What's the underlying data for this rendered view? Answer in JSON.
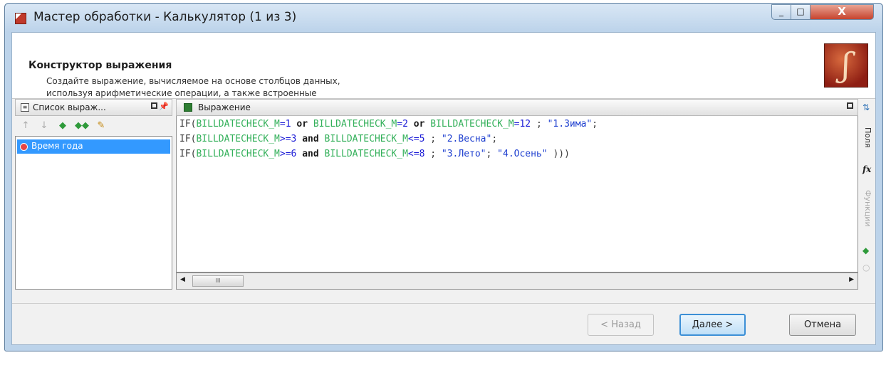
{
  "window": {
    "title": "Мастер обработки - Калькулятор (1 из 3)",
    "close_glyph": "X"
  },
  "header": {
    "title": "Конструктор выражения",
    "description_line1": "Создайте выражение, вычисляемое на основе столбцов данных,",
    "description_line2": "используя арифметические операции, а также встроенные"
  },
  "left_panel": {
    "title": "Список выраж...",
    "items": [
      {
        "label": "Время года",
        "selected": true
      }
    ]
  },
  "right_panel": {
    "title": "Выражение",
    "code": {
      "line1": [
        {
          "t": "IF(",
          "c": "kw"
        },
        {
          "t": "BILLDATECHECK_M",
          "c": "fld"
        },
        {
          "t": "=1",
          "c": "op"
        },
        {
          "t": " or ",
          "c": "kwb"
        },
        {
          "t": "BILLDATECHECK_M",
          "c": "fld"
        },
        {
          "t": "=2",
          "c": "op"
        },
        {
          "t": " or ",
          "c": "kwb"
        },
        {
          "t": "BILLDATECHECK_M",
          "c": "fld"
        },
        {
          "t": "=12",
          "c": "op"
        },
        {
          "t": " ; ",
          "c": "kw"
        },
        {
          "t": "\"1.Зима\"",
          "c": "str"
        },
        {
          "t": ";",
          "c": "kw"
        }
      ],
      "line2": [
        {
          "t": "IF(",
          "c": "kw"
        },
        {
          "t": "BILLDATECHECK_M",
          "c": "fld"
        },
        {
          "t": ">=3",
          "c": "op"
        },
        {
          "t": " and ",
          "c": "kwb"
        },
        {
          "t": "BILLDATECHECK_M",
          "c": "fld"
        },
        {
          "t": "<=5",
          "c": "op"
        },
        {
          "t": " ; ",
          "c": "kw"
        },
        {
          "t": "\"2.Весна\"",
          "c": "str"
        },
        {
          "t": ";",
          "c": "kw"
        }
      ],
      "line3": [
        {
          "t": "IF(",
          "c": "kw"
        },
        {
          "t": "BILLDATECHECK_M",
          "c": "fld"
        },
        {
          "t": ">=6",
          "c": "op"
        },
        {
          "t": " and ",
          "c": "kwb"
        },
        {
          "t": "BILLDATECHECK_M",
          "c": "fld"
        },
        {
          "t": "<=8",
          "c": "op"
        },
        {
          "t": " ; ",
          "c": "kw"
        },
        {
          "t": "\"3.Лето\"",
          "c": "str"
        },
        {
          "t": "; ",
          "c": "kw"
        },
        {
          "t": "\"4.Осень\"",
          "c": "str"
        },
        {
          "t": " )))",
          "c": "kw"
        }
      ]
    },
    "scroll_thumb": "III"
  },
  "side_tabs": {
    "fields_tab": "Поля",
    "functions_tab": "Функции",
    "fx_icon": "fx"
  },
  "footer": {
    "back_label": "< Назад",
    "next_label": "Далее >",
    "cancel_label": "Отмена"
  }
}
